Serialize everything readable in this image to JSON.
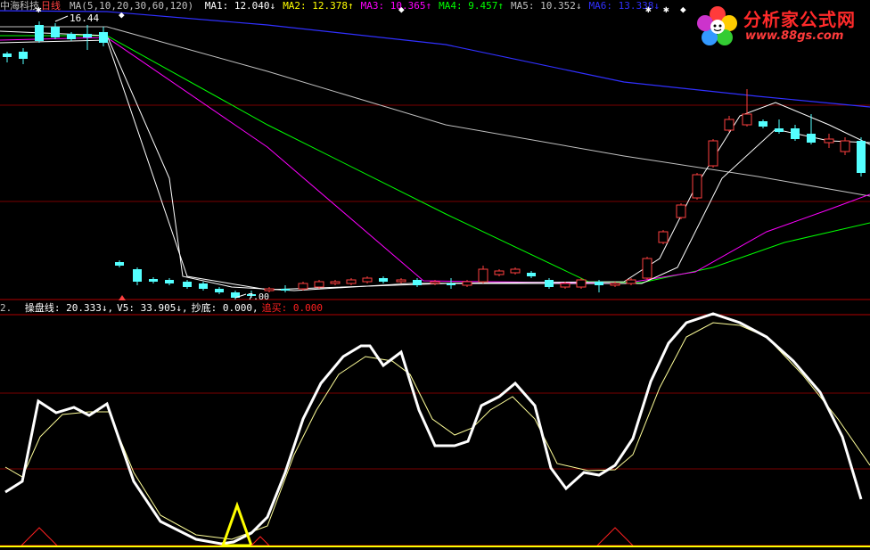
{
  "header": {
    "stock_name": "中海科技",
    "period": "日线",
    "ma_label": "MA(5,10,20,30,60,120)",
    "ma": [
      {
        "name": "MA1:",
        "value": "12.040",
        "arrow": "↓",
        "color": "#ffffff"
      },
      {
        "name": "MA2:",
        "value": "12.378",
        "arrow": "↑",
        "color": "#ffff00"
      },
      {
        "name": "MA3:",
        "value": "10.365",
        "arrow": "↑",
        "color": "#ff00ff"
      },
      {
        "name": "MA4:",
        "value": "9.457",
        "arrow": "↑",
        "color": "#00ff00"
      },
      {
        "name": "MA5:",
        "value": "10.352",
        "arrow": "↓",
        "color": "#c0c0c0"
      },
      {
        "name": "MA6:",
        "value": "13.338",
        "arrow": "↓",
        "color": "#3030ff"
      }
    ]
  },
  "price_labels": {
    "high": "16.44",
    "low": "7.00"
  },
  "indicator": {
    "index": "2.",
    "items": [
      {
        "name": "操盘线:",
        "value": "20.333",
        "arrow": "↓",
        "color": "#ffffff"
      },
      {
        "name": "V5:",
        "value": "33.905",
        "arrow": "↓",
        "color": "#ffffff"
      },
      {
        "name": "抄底:",
        "value": "0.000",
        "arrow": "",
        "color": "#ffffff"
      },
      {
        "name": "追买:",
        "value": "0.000",
        "arrow": "",
        "color": "#ff2020"
      }
    ]
  },
  "logo": {
    "title": "分析家公式网",
    "url": "www.88gs.com"
  },
  "markers": {
    "star": "✱",
    "diamond": "◆"
  },
  "colors": {
    "background": "#000000",
    "up": "#ff4040",
    "down": "#54ffff",
    "grid": "#7a0000",
    "ma1": "#ffffff",
    "ma2": "#ffff00",
    "ma3": "#ff00ff",
    "ma4": "#00ff00",
    "ma5": "#c0c0c0",
    "ma6": "#3030ff"
  }
}
